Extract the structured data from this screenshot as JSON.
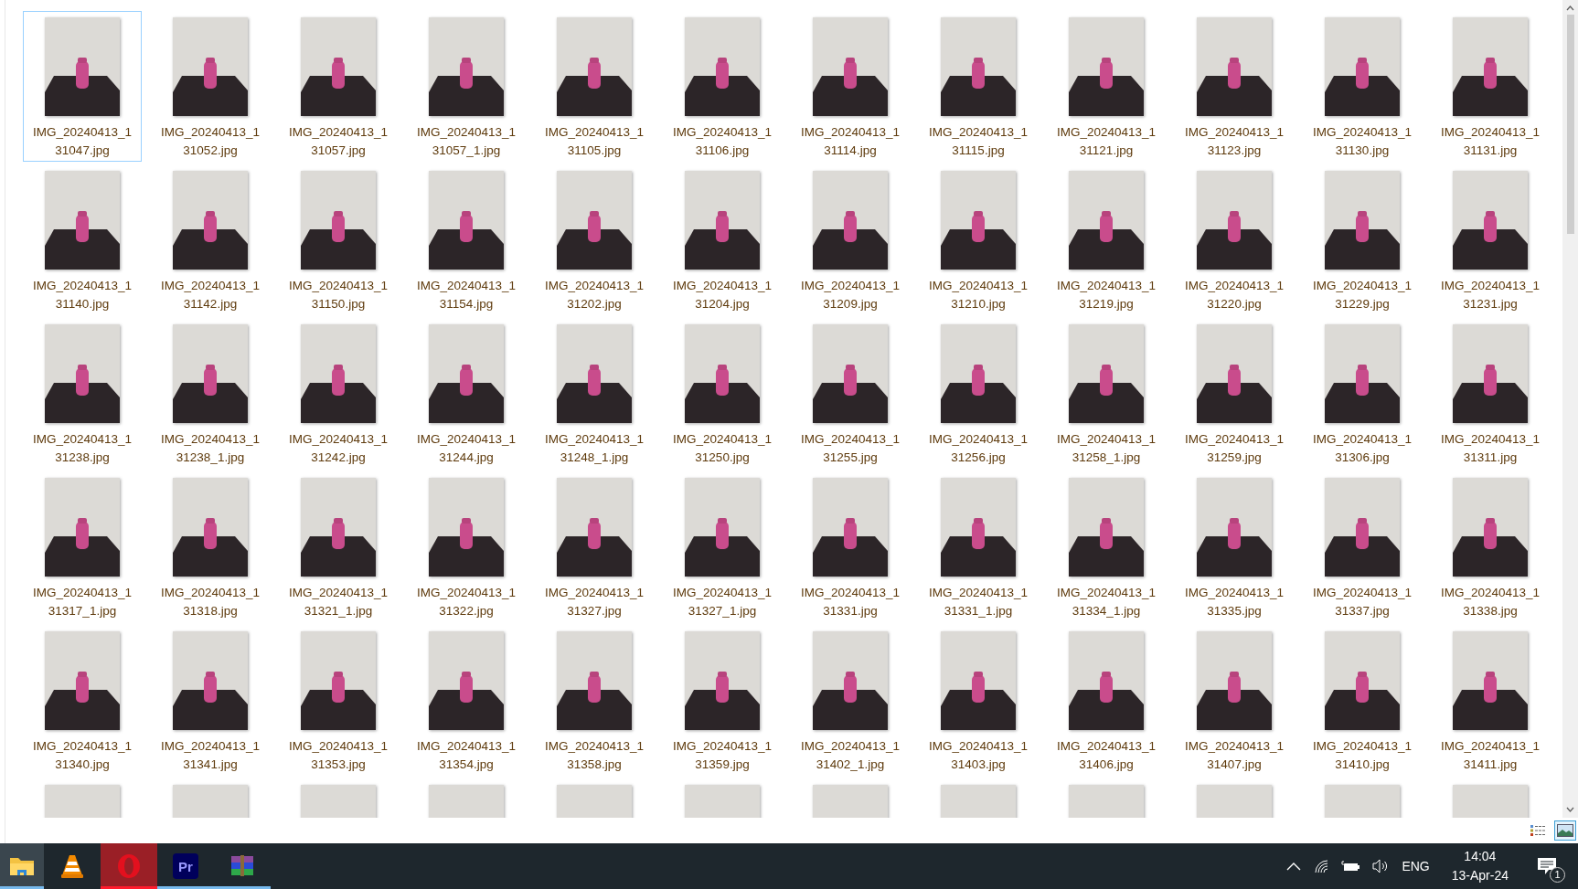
{
  "files": [
    {
      "name": "IMG_20240413_131047.jpg",
      "selected": true
    },
    {
      "name": "IMG_20240413_131052.jpg",
      "selected": false
    },
    {
      "name": "IMG_20240413_131057.jpg",
      "selected": false
    },
    {
      "name": "IMG_20240413_131057_1.jpg",
      "selected": false
    },
    {
      "name": "IMG_20240413_131105.jpg",
      "selected": false
    },
    {
      "name": "IMG_20240413_131106.jpg",
      "selected": false
    },
    {
      "name": "IMG_20240413_131114.jpg",
      "selected": false
    },
    {
      "name": "IMG_20240413_131115.jpg",
      "selected": false
    },
    {
      "name": "IMG_20240413_131121.jpg",
      "selected": false
    },
    {
      "name": "IMG_20240413_131123.jpg",
      "selected": false
    },
    {
      "name": "IMG_20240413_131130.jpg",
      "selected": false
    },
    {
      "name": "IMG_20240413_131131.jpg",
      "selected": false
    },
    {
      "name": "IMG_20240413_131140.jpg",
      "selected": false
    },
    {
      "name": "IMG_20240413_131142.jpg",
      "selected": false
    },
    {
      "name": "IMG_20240413_131150.jpg",
      "selected": false
    },
    {
      "name": "IMG_20240413_131154.jpg",
      "selected": false
    },
    {
      "name": "IMG_20240413_131202.jpg",
      "selected": false
    },
    {
      "name": "IMG_20240413_131204.jpg",
      "selected": false
    },
    {
      "name": "IMG_20240413_131209.jpg",
      "selected": false
    },
    {
      "name": "IMG_20240413_131210.jpg",
      "selected": false
    },
    {
      "name": "IMG_20240413_131219.jpg",
      "selected": false
    },
    {
      "name": "IMG_20240413_131220.jpg",
      "selected": false
    },
    {
      "name": "IMG_20240413_131229.jpg",
      "selected": false
    },
    {
      "name": "IMG_20240413_131231.jpg",
      "selected": false
    },
    {
      "name": "IMG_20240413_131238.jpg",
      "selected": false
    },
    {
      "name": "IMG_20240413_131238_1.jpg",
      "selected": false
    },
    {
      "name": "IMG_20240413_131242.jpg",
      "selected": false
    },
    {
      "name": "IMG_20240413_131244.jpg",
      "selected": false
    },
    {
      "name": "IMG_20240413_131248_1.jpg",
      "selected": false
    },
    {
      "name": "IMG_20240413_131250.jpg",
      "selected": false
    },
    {
      "name": "IMG_20240413_131255.jpg",
      "selected": false
    },
    {
      "name": "IMG_20240413_131256.jpg",
      "selected": false
    },
    {
      "name": "IMG_20240413_131258_1.jpg",
      "selected": false
    },
    {
      "name": "IMG_20240413_131259.jpg",
      "selected": false
    },
    {
      "name": "IMG_20240413_131306.jpg",
      "selected": false
    },
    {
      "name": "IMG_20240413_131311.jpg",
      "selected": false
    },
    {
      "name": "IMG_20240413_131317_1.jpg",
      "selected": false
    },
    {
      "name": "IMG_20240413_131318.jpg",
      "selected": false
    },
    {
      "name": "IMG_20240413_131321_1.jpg",
      "selected": false
    },
    {
      "name": "IMG_20240413_131322.jpg",
      "selected": false
    },
    {
      "name": "IMG_20240413_131327.jpg",
      "selected": false
    },
    {
      "name": "IMG_20240413_131327_1.jpg",
      "selected": false
    },
    {
      "name": "IMG_20240413_131331.jpg",
      "selected": false
    },
    {
      "name": "IMG_20240413_131331_1.jpg",
      "selected": false
    },
    {
      "name": "IMG_20240413_131334_1.jpg",
      "selected": false
    },
    {
      "name": "IMG_20240413_131335.jpg",
      "selected": false
    },
    {
      "name": "IMG_20240413_131337.jpg",
      "selected": false
    },
    {
      "name": "IMG_20240413_131338.jpg",
      "selected": false
    },
    {
      "name": "IMG_20240413_131340.jpg",
      "selected": false
    },
    {
      "name": "IMG_20240413_131341.jpg",
      "selected": false
    },
    {
      "name": "IMG_20240413_131353.jpg",
      "selected": false
    },
    {
      "name": "IMG_20240413_131354.jpg",
      "selected": false
    },
    {
      "name": "IMG_20240413_131358.jpg",
      "selected": false
    },
    {
      "name": "IMG_20240413_131359.jpg",
      "selected": false
    },
    {
      "name": "IMG_20240413_131402_1.jpg",
      "selected": false
    },
    {
      "name": "IMG_20240413_131403.jpg",
      "selected": false
    },
    {
      "name": "IMG_20240413_131406.jpg",
      "selected": false
    },
    {
      "name": "IMG_20240413_131407.jpg",
      "selected": false
    },
    {
      "name": "IMG_20240413_131410.jpg",
      "selected": false
    },
    {
      "name": "IMG_20240413_131411.jpg",
      "selected": false
    },
    {
      "selected": false
    },
    {
      "selected": false
    },
    {
      "selected": false
    },
    {
      "selected": false
    },
    {
      "selected": false
    },
    {
      "selected": false
    },
    {
      "selected": false
    },
    {
      "selected": false
    },
    {
      "selected": false
    },
    {
      "selected": false
    },
    {
      "selected": false
    },
    {
      "selected": false
    }
  ],
  "view_buttons": [
    {
      "kind": "details",
      "selected": false
    },
    {
      "kind": "thumbnails",
      "selected": true
    }
  ],
  "taskbar": {
    "apps": [
      {
        "kind": "folder",
        "selected": true,
        "running": true,
        "hovered": false
      },
      {
        "kind": "cone",
        "selected": false,
        "running": false,
        "hovered": false
      },
      {
        "kind": "ring",
        "selected": false,
        "running": true,
        "hovered": true
      },
      {
        "kind": "badge",
        "text": "Pr",
        "selected": false,
        "running": true,
        "hovered": false
      },
      {
        "kind": "books",
        "selected": false,
        "running": true,
        "hovered": false
      }
    ],
    "language": "ENG",
    "time": "14:04",
    "date": "13-Apr-24",
    "notifications": "1"
  }
}
